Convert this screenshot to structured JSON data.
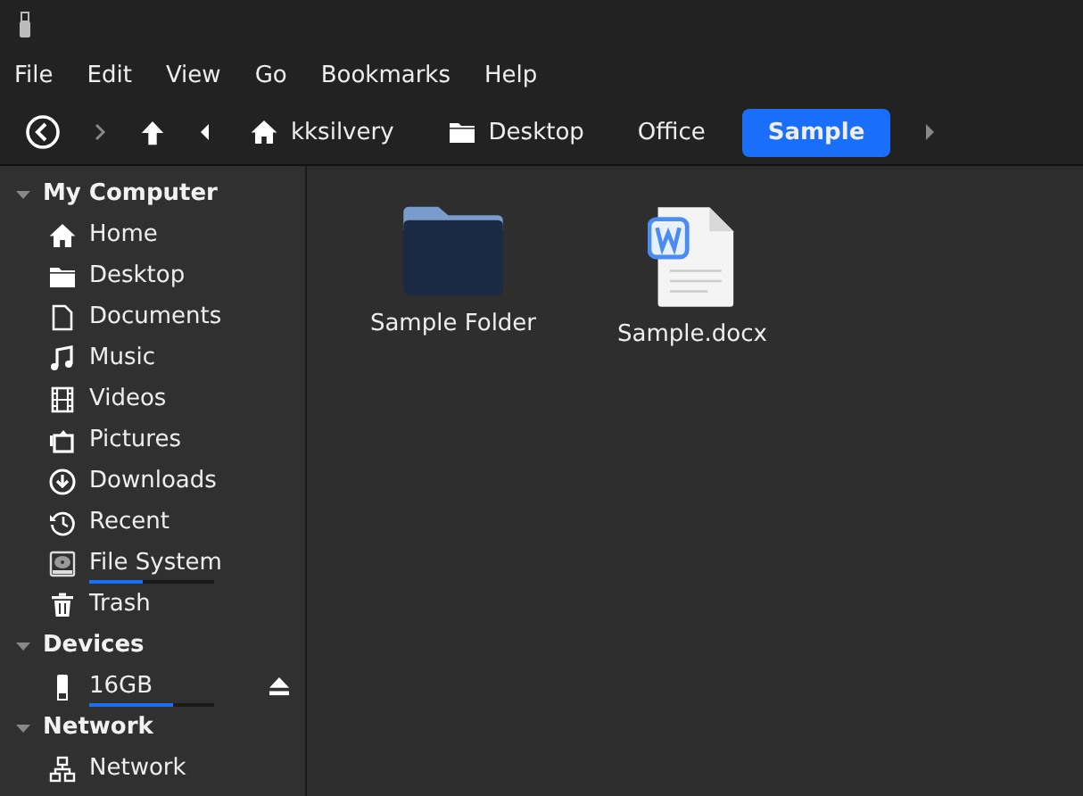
{
  "menu": [
    "File",
    "Edit",
    "View",
    "Go",
    "Bookmarks",
    "Help"
  ],
  "path": [
    {
      "label": "kksilvery",
      "selected": false
    },
    {
      "label": "Desktop",
      "selected": false
    },
    {
      "label": "Office",
      "selected": false
    },
    {
      "label": "Sample",
      "selected": true
    }
  ],
  "sidebar": [
    {
      "title": "My Computer",
      "expanded": true,
      "items": [
        {
          "label": "Home"
        },
        {
          "label": "Desktop"
        },
        {
          "label": "Documents"
        },
        {
          "label": "Music"
        },
        {
          "label": "Videos"
        },
        {
          "label": "Pictures"
        },
        {
          "label": "Downloads"
        },
        {
          "label": "Recent"
        },
        {
          "label": "File System",
          "level": 0.43
        },
        {
          "label": "Trash"
        }
      ]
    },
    {
      "title": "Devices",
      "expanded": true,
      "items": [
        {
          "label": "16GB",
          "level": 0.67
        }
      ]
    },
    {
      "title": "Network",
      "expanded": true,
      "items": [
        {
          "label": "Network"
        }
      ]
    }
  ],
  "files": [
    {
      "name": "Sample Folder",
      "kind": "folder"
    },
    {
      "name": "Sample.docx",
      "kind": "document"
    }
  ]
}
